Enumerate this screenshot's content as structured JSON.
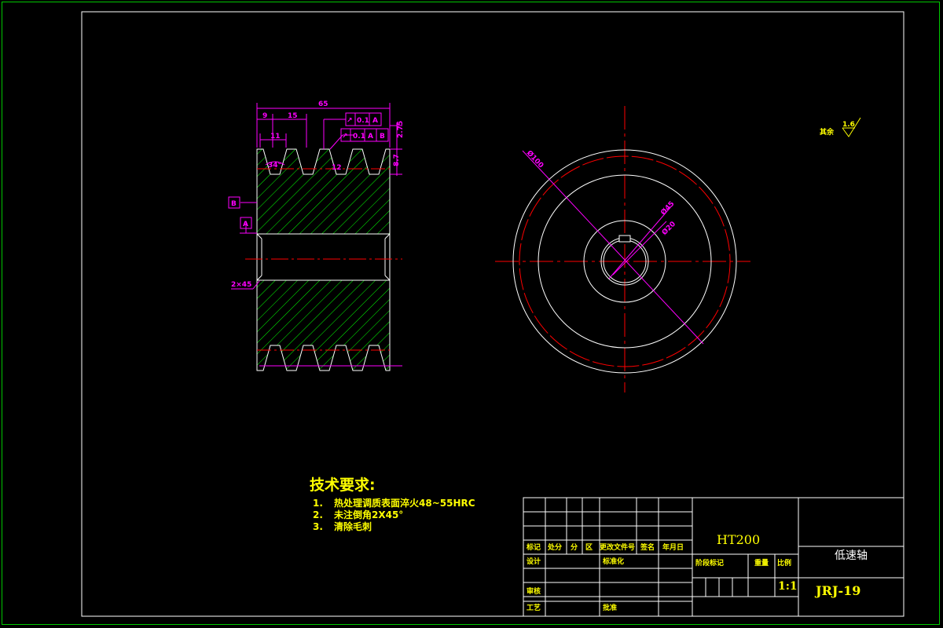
{
  "colors": {
    "background": "#000000",
    "frame": "#00c800",
    "lines": "#ffffff",
    "dimension": "#ff00ff",
    "centerline": "#ff0000",
    "hatch": "#00ff00",
    "text_yellow": "#ffff00"
  },
  "section_view": {
    "overall_width": "65",
    "dim_9": "9",
    "dim_15": "15",
    "dim_11": "11",
    "groove_angle": "34°",
    "dim_12": "12",
    "dim_2_75": "2.75",
    "dim_8_7": "8.7",
    "chamfer": "2×45",
    "datum_b": "B",
    "datum_a": "A",
    "tol1_value": "0.1",
    "tol1_datum": "A",
    "tol2_value": "0.1",
    "tol2_datum_a": "A",
    "tol2_datum_b": "B"
  },
  "front_view": {
    "dia_outer": "Ø100",
    "dia_hub": "Ø45",
    "dia_bore": "Ø20"
  },
  "roughness": {
    "label": "其余",
    "value": "1.6"
  },
  "tech_requirements": {
    "title": "技术要求:",
    "items": [
      {
        "num": "1.",
        "text": "热处理调质表面淬火48~55HRC"
      },
      {
        "num": "2.",
        "text": "未注倒角2X45°"
      },
      {
        "num": "3.",
        "text": "清除毛刺"
      }
    ]
  },
  "title_block": {
    "material": "HT200",
    "part_name": "低速轴",
    "drawing_no": "JRJ-19",
    "scale": "1:1",
    "headers": [
      "标记",
      "处分",
      "分",
      "区",
      "更改文件号",
      "签名",
      "年月日"
    ],
    "row_design": "设计",
    "row_standard": "标准化",
    "row_review": "审核",
    "row_process": "工艺",
    "row_approve": "批准",
    "stage_label": "阶段标记",
    "weight_label": "重量",
    "scale_label": "比例"
  }
}
